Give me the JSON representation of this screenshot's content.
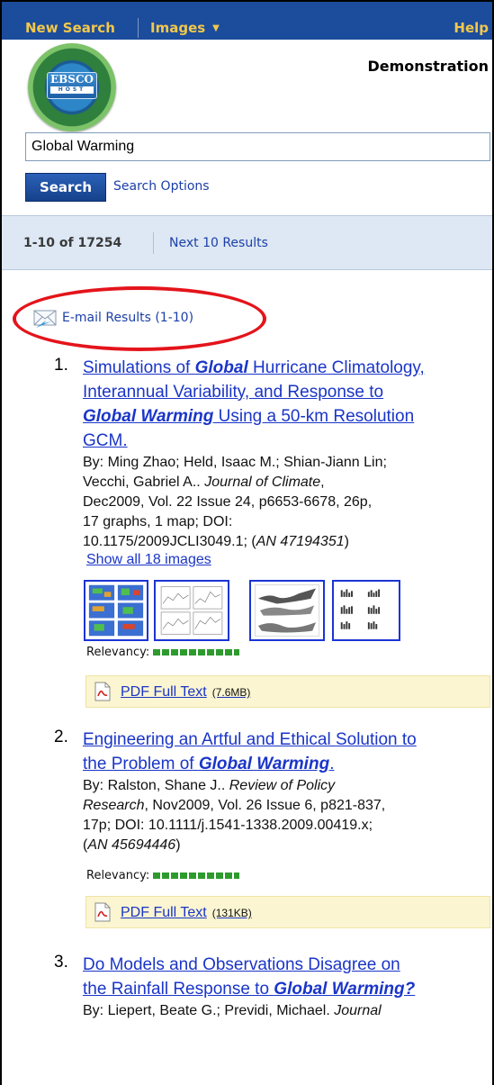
{
  "nav": {
    "new_search": "New Search",
    "images": "Images",
    "help": "Help"
  },
  "logo": {
    "ebsco": "EBSCO",
    "host": "HOST"
  },
  "account": "Demonstration",
  "search": {
    "query": "Global Warming",
    "button": "Search",
    "options": "Search Options"
  },
  "results_bar": {
    "range": "1-10 of 17254",
    "next": "Next 10 Results"
  },
  "email": {
    "label": "E-mail Results (1-10)",
    "icon": "email-icon"
  },
  "results": [
    {
      "num": "1.",
      "title_lines": [
        [
          {
            "t": "Simulations of ",
            "kw": false
          },
          {
            "t": "Global",
            "kw": true
          },
          {
            "t": " Hurricane Climatology,",
            "kw": false
          }
        ],
        [
          {
            "t": "Interannual Variability, and Response to",
            "kw": false
          }
        ],
        [
          {
            "t": "Global Warming",
            "kw": true
          },
          {
            "t": " Using a 50-km Resolution",
            "kw": false
          }
        ],
        [
          {
            "t": "GCM.",
            "kw": false
          }
        ]
      ],
      "cite_lines": [
        [
          {
            "t": "By: Ming Zhao; Held, Isaac M.; Shian-Jiann Lin;",
            "i": false
          }
        ],
        [
          {
            "t": "Vecchi, Gabriel A.. ",
            "i": false
          },
          {
            "t": "Journal of Climate",
            "i": true
          },
          {
            "t": ",",
            "i": false
          }
        ],
        [
          {
            "t": "Dec2009, Vol. 22 Issue 24, p6653-6678, 26p,",
            "i": false
          }
        ],
        [
          {
            "t": "17 graphs, 1 map; DOI:",
            "i": false
          }
        ],
        [
          {
            "t": "10.1175/2009JCLI3049.1; (",
            "i": false
          },
          {
            "t": "AN 47194351",
            "i": true
          },
          {
            "t": ")",
            "i": false
          }
        ]
      ],
      "show_images": "Show all 18 images",
      "relevancy": "Relevancy:",
      "pdf_label": "PDF Full Text",
      "pdf_size": "(7.6MB)"
    },
    {
      "num": "2.",
      "title_lines": [
        [
          {
            "t": "Engineering an Artful and Ethical Solution to",
            "kw": false
          }
        ],
        [
          {
            "t": "the Problem of ",
            "kw": false
          },
          {
            "t": "Global Warming",
            "kw": true
          },
          {
            "t": ".",
            "kw": false
          }
        ]
      ],
      "cite_lines": [
        [
          {
            "t": "By: Ralston, Shane J.. ",
            "i": false
          },
          {
            "t": "Review of Policy",
            "i": true
          }
        ],
        [
          {
            "t": "Research",
            "i": true
          },
          {
            "t": ", Nov2009, Vol. 26 Issue 6, p821-837,",
            "i": false
          }
        ],
        [
          {
            "t": "17p; DOI: 10.1111/j.1541-1338.2009.00419.x;",
            "i": false
          }
        ],
        [
          {
            "t": "(",
            "i": false
          },
          {
            "t": "AN 45694446",
            "i": true
          },
          {
            "t": ")",
            "i": false
          }
        ]
      ],
      "relevancy": "Relevancy:",
      "pdf_label": "PDF Full Text",
      "pdf_size": "(131KB)"
    },
    {
      "num": "3.",
      "title_lines": [
        [
          {
            "t": "Do Models and Observations Disagree on",
            "kw": false
          }
        ],
        [
          {
            "t": "the Rainfall Response to ",
            "kw": false
          },
          {
            "t": "Global Warming?",
            "kw": true
          }
        ]
      ],
      "cite_lines": [
        [
          {
            "t": "By: Liepert, Beate G.; Previdi, Michael. ",
            "i": false
          },
          {
            "t": "Journal",
            "i": true
          }
        ]
      ]
    }
  ],
  "colors": {
    "nav_bg": "#1c4c9c",
    "nav_text": "#f2c84b",
    "link": "#1a35c8",
    "highlight_ring": "#e4141b",
    "results_bar_bg": "#dde8f4",
    "pdf_box_bg": "#fbf5d1"
  }
}
